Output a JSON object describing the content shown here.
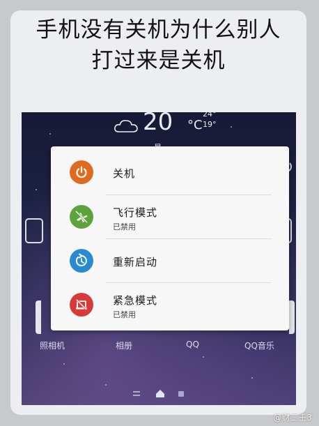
{
  "headline": {
    "line1": "手机没有关机为什么别人",
    "line2": "打过来是关机"
  },
  "weather": {
    "icon": "cloud-icon",
    "temperature": "20",
    "unit": "°C",
    "high": "24°",
    "low": "19°",
    "date_fragment": "星"
  },
  "power_menu": {
    "items": [
      {
        "label": "关机",
        "sublabel": "",
        "icon": "power-icon",
        "color": "#e06a1f"
      },
      {
        "label": "飞行模式",
        "sublabel": "已禁用",
        "icon": "airplane-icon",
        "color": "#5da33b"
      },
      {
        "label": "重新启动",
        "sublabel": "",
        "icon": "restart-icon",
        "color": "#2a8ad0"
      },
      {
        "label": "紧急模式",
        "sublabel": "已禁用",
        "icon": "emergency-icon",
        "color": "#d83a3a"
      }
    ]
  },
  "dock": {
    "apps": [
      "照相机",
      "相册",
      "QQ",
      "QQ音乐"
    ]
  },
  "watermark": "@财二王3"
}
